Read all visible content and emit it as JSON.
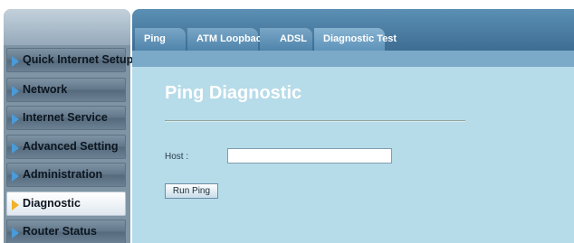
{
  "sidebar": {
    "items": [
      {
        "label": "Quick Internet Setup",
        "active": false
      },
      {
        "label": "Network",
        "active": false
      },
      {
        "label": "Internet Service",
        "active": false
      },
      {
        "label": "Advanced Setting",
        "active": false
      },
      {
        "label": "Administration",
        "active": false
      },
      {
        "label": "Diagnostic",
        "active": true
      },
      {
        "label": "Router Status",
        "active": false
      }
    ]
  },
  "tabs": [
    {
      "label": "Ping",
      "active": false
    },
    {
      "label": "ATM Loopback",
      "active": false
    },
    {
      "label": "ADSL",
      "active": false
    },
    {
      "label": "Diagnostic Test",
      "active": true
    }
  ],
  "main": {
    "title": "Ping Diagnostic",
    "host_label": "Host :",
    "host_value": "",
    "run_button_label": "Run Ping"
  },
  "colors": {
    "tab_bar": "#3e6d93",
    "content_bg": "#b6dbe9",
    "sidebar_bg": "#7f95a5",
    "arrow_blue": "#4a9bd9",
    "arrow_active": "#f0b22a"
  }
}
